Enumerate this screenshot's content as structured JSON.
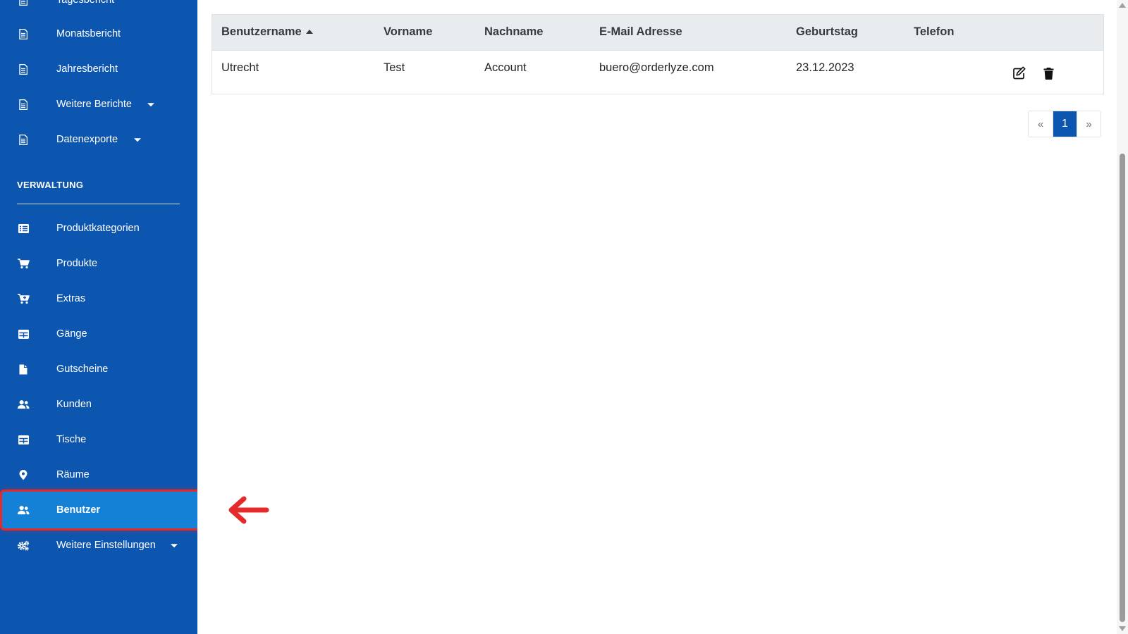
{
  "sidebar": {
    "items_top": [
      {
        "label": "Tagesbericht",
        "icon": "document-icon"
      },
      {
        "label": "Monatsbericht",
        "icon": "document-icon"
      },
      {
        "label": "Jahresbericht",
        "icon": "document-icon"
      },
      {
        "label": "Weitere Berichte",
        "icon": "document-icon",
        "dropdown": true
      },
      {
        "label": "Datenexporte",
        "icon": "document-icon",
        "dropdown": true
      }
    ],
    "section_title": "VERWALTUNG",
    "items": [
      {
        "label": "Produktkategorien",
        "icon": "list-icon"
      },
      {
        "label": "Produkte",
        "icon": "cart-icon"
      },
      {
        "label": "Extras",
        "icon": "cart-plus-icon"
      },
      {
        "label": "Gänge",
        "icon": "table-icon"
      },
      {
        "label": "Gutscheine",
        "icon": "file-icon"
      },
      {
        "label": "Kunden",
        "icon": "users-icon"
      },
      {
        "label": "Tische",
        "icon": "table-icon"
      },
      {
        "label": "Räume",
        "icon": "map-marker-icon"
      },
      {
        "label": "Benutzer",
        "icon": "users-icon",
        "active": true
      },
      {
        "label": "Weitere Einstellungen",
        "icon": "cogs-icon",
        "dropdown": true
      }
    ]
  },
  "users_table": {
    "columns": [
      "Benutzername",
      "Vorname",
      "Nachname",
      "E-Mail Adresse",
      "Geburtstag",
      "Telefon",
      ""
    ],
    "sorted_column": "Benutzername",
    "sort_direction": "ascending",
    "rows": [
      {
        "username": "Utrecht",
        "firstname": "Test",
        "lastname": "Account",
        "email": "buero@orderlyze.com",
        "birthday": "23.12.2023",
        "phone": ""
      }
    ]
  },
  "pagination": {
    "prev": "«",
    "current": "1",
    "next": "»"
  },
  "colors": {
    "sidebar_bg": "#0d56b0",
    "active_item_bg": "#1581d6",
    "highlight": "#e32b2b",
    "table_header_bg": "#e9ecef"
  }
}
